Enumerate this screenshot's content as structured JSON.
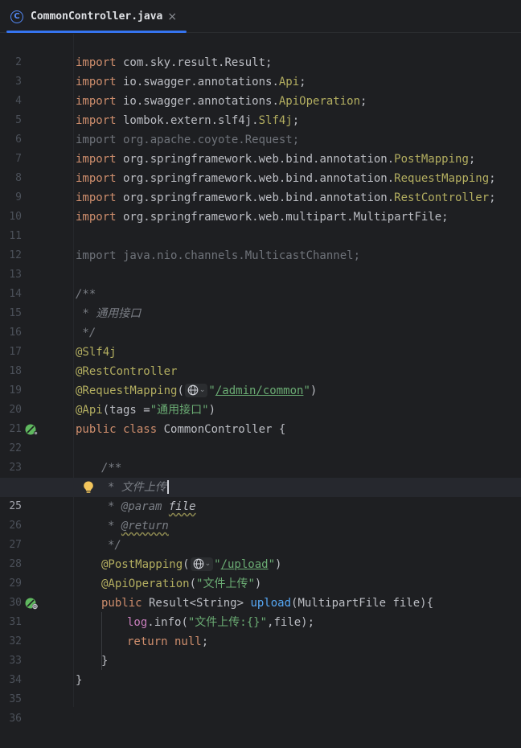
{
  "tab": {
    "icon": "class-icon",
    "icon_letter": "C",
    "file_name": "CommonController.java",
    "close_glyph": "×"
  },
  "colors": {
    "background": "#1e1f22",
    "keyword": "#cf8e6d",
    "annotation": "#b3ae60",
    "comment": "#7a7e85",
    "string": "#6aab73",
    "method": "#56a8f5",
    "field": "#c77dbb",
    "accent": "#3574f0"
  },
  "editor": {
    "current_line": 25,
    "lines": [
      {
        "n": "2"
      },
      {
        "n": "3",
        "t": [
          "import",
          " com.sky.result.Result;"
        ]
      },
      {
        "n": "4",
        "t": [
          "import",
          " io.swagger.annotations.",
          "Api",
          ";"
        ]
      },
      {
        "n": "5",
        "t": [
          "import",
          " io.swagger.annotations.",
          "ApiOperation",
          ";"
        ]
      },
      {
        "n": "6",
        "t": [
          "import",
          " lombok.extern.slf4j.",
          "Slf4j",
          ";"
        ]
      },
      {
        "n": "7",
        "t": [
          "import org.apache.coyote.Request;"
        ]
      },
      {
        "n": "8",
        "t": [
          "import",
          " org.springframework.web.bind.annotation.",
          "PostMapping",
          ";"
        ]
      },
      {
        "n": "9",
        "t": [
          "import",
          " org.springframework.web.bind.annotation.",
          "RequestMapping",
          ";"
        ]
      },
      {
        "n": "10",
        "t": [
          "import",
          " org.springframework.web.bind.annotation.",
          "RestController",
          ";"
        ]
      },
      {
        "n": "11",
        "t": [
          "import",
          " org.springframework.web.multipart.MultipartFile;"
        ]
      },
      {
        "n": "12"
      },
      {
        "n": "13",
        "t": [
          "import java.nio.channels.MulticastChannel;"
        ]
      },
      {
        "n": "14"
      },
      {
        "n": "15",
        "t": [
          "/**"
        ]
      },
      {
        "n": "16",
        "t": [
          " * 通用接口"
        ]
      },
      {
        "n": "17",
        "t": [
          " */"
        ]
      },
      {
        "n": "18",
        "t": [
          "@Slf4j"
        ]
      },
      {
        "n": "19",
        "t": [
          "@RestController"
        ]
      },
      {
        "n": "20",
        "t": [
          "@RequestMapping",
          "(",
          "\"",
          "/admin/common",
          "\"",
          ")"
        ]
      },
      {
        "n": "21",
        "t": [
          "@Api",
          "(tags =",
          "\"通用接口\"",
          ")"
        ]
      },
      {
        "n": "22",
        "t": [
          "public class",
          " CommonController {"
        ]
      },
      {
        "n": "23"
      },
      {
        "n": "24",
        "t": [
          "/**"
        ]
      },
      {
        "n": "25",
        "t": [
          "* 文件上传"
        ]
      },
      {
        "n": "26",
        "t": [
          "* ",
          "@param",
          " ",
          "file"
        ]
      },
      {
        "n": "27",
        "t": [
          "* ",
          "@return"
        ]
      },
      {
        "n": "28",
        "t": [
          "*/"
        ]
      },
      {
        "n": "29",
        "t": [
          "@PostMapping",
          "(",
          "\"",
          "/upload",
          "\"",
          ")"
        ]
      },
      {
        "n": "30",
        "t": [
          "@ApiOperation",
          "(",
          "\"文件上传\"",
          ")"
        ]
      },
      {
        "n": "31",
        "t": [
          "public",
          " Result<String> ",
          "upload",
          "(MultipartFile file){"
        ]
      },
      {
        "n": "32",
        "t": [
          "log",
          ".info(",
          "\"文件上传:{}\"",
          ",file);"
        ]
      },
      {
        "n": "33",
        "t": [
          "return null",
          ";"
        ]
      },
      {
        "n": "34",
        "t": [
          "}"
        ]
      },
      {
        "n": "35",
        "t": [
          "}"
        ]
      },
      {
        "n": "36"
      }
    ]
  },
  "gutter_icons": {
    "line_22": "spring-bean-icon",
    "line_25": "lightbulb-icon",
    "line_31": "spring-web-endpoint-icon",
    "inline_hint": "globe-icon"
  }
}
